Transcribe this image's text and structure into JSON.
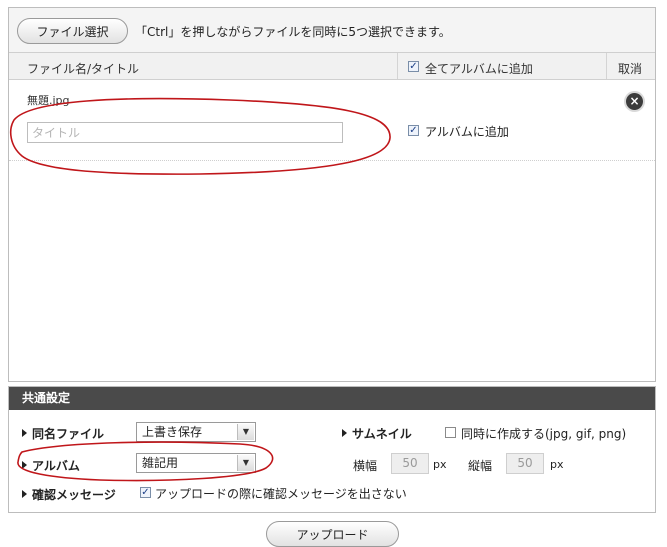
{
  "toolbar": {
    "select_button": "ファイル選択",
    "hint": "「Ctrl」を押しながらファイルを同時に5つ選択できます。"
  },
  "columns": {
    "file_title": "ファイル名/タイトル",
    "add_all": "全てアルバムに追加",
    "cancel": "取消"
  },
  "file_item": {
    "filename": "無題.jpg",
    "title_placeholder": "タイトル",
    "title_value": "",
    "add_album_label": "アルバムに追加",
    "add_album_checked": true
  },
  "settings": {
    "header": "共通設定",
    "same_name_label": "同名ファイル",
    "same_name_value": "上書き保存",
    "album_label": "アルバム",
    "album_value": "雑記用",
    "confirm_label": "確認メッセージ",
    "confirm_checkbox_label": "アップロードの際に確認メッセージを出さない",
    "thumbnail_label": "サムネイル",
    "thumbnail_checkbox_label": "同時に作成する(jpg, gif, png)",
    "width_label": "横幅",
    "width_value": "50",
    "height_label": "縦幅",
    "height_value": "50",
    "unit": "px"
  },
  "upload_button": "アップロード",
  "colors": {
    "annotation_red": "#c0161a",
    "settings_header_bg": "#4a4a4a"
  },
  "icons": {
    "remove": "close-circle-icon",
    "checkbox": "check-icon",
    "dropdown": "chevron-down-icon",
    "section_marker": "triangle-right-icon"
  }
}
